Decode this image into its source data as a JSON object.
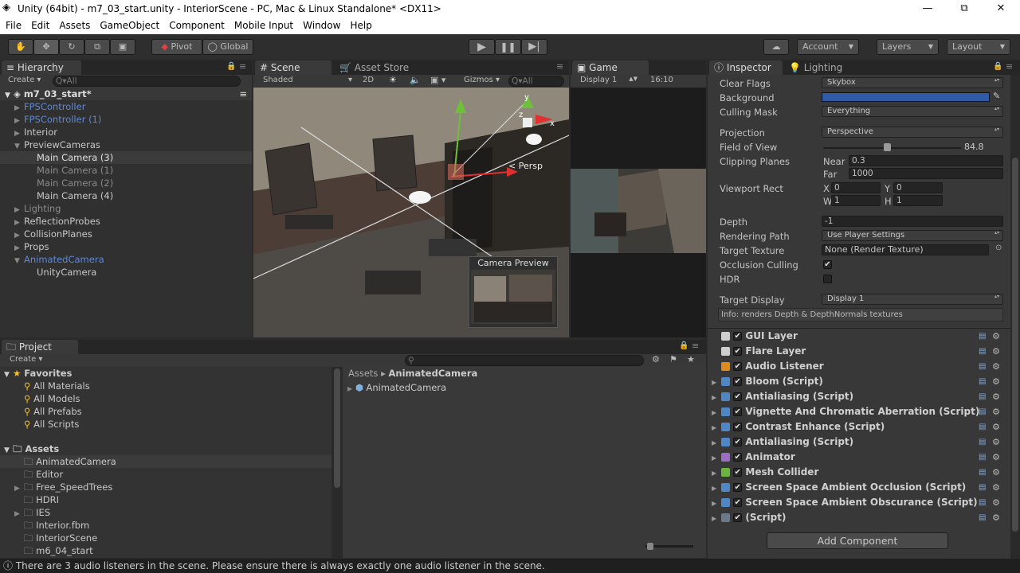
{
  "window": {
    "title": "Unity (64bit) - m7_03_start.unity - InteriorScene - PC, Mac & Linux Standalone* <DX11>"
  },
  "menu": [
    "File",
    "Edit",
    "Assets",
    "GameObject",
    "Component",
    "Mobile Input",
    "Window",
    "Help"
  ],
  "toolbar": {
    "pivot": "Pivot",
    "global": "Global",
    "account": "Account",
    "layers": "Layers",
    "layout": "Layout"
  },
  "hierarchy": {
    "tab": "Hierarchy",
    "create": "Create",
    "search_placeholder": "Q▾All",
    "scene": "m7_03_start*",
    "items": [
      {
        "label": "FPSController",
        "style": "blue",
        "indent": 0,
        "arrow": "▶"
      },
      {
        "label": "FPSController (1)",
        "style": "blue",
        "indent": 0,
        "arrow": "▶"
      },
      {
        "label": "Interior",
        "style": "",
        "indent": 0,
        "arrow": "▶"
      },
      {
        "label": "PreviewCameras",
        "style": "",
        "indent": 0,
        "arrow": "▼"
      },
      {
        "label": "Main Camera (3)",
        "style": "sel",
        "indent": 1,
        "arrow": ""
      },
      {
        "label": "Main Camera (1)",
        "style": "dim",
        "indent": 1,
        "arrow": ""
      },
      {
        "label": "Main Camera (2)",
        "style": "dim",
        "indent": 1,
        "arrow": ""
      },
      {
        "label": "Main Camera (4)",
        "style": "",
        "indent": 1,
        "arrow": ""
      },
      {
        "label": "Lighting",
        "style": "dim",
        "indent": 0,
        "arrow": "▶"
      },
      {
        "label": "ReflectionProbes",
        "style": "",
        "indent": 0,
        "arrow": "▶"
      },
      {
        "label": "CollisionPlanes",
        "style": "",
        "indent": 0,
        "arrow": "▶"
      },
      {
        "label": "Props",
        "style": "",
        "indent": 0,
        "arrow": "▶"
      },
      {
        "label": "AnimatedCamera",
        "style": "blue",
        "indent": 0,
        "arrow": "▼"
      },
      {
        "label": "UnityCamera",
        "style": "",
        "indent": 1,
        "arrow": ""
      }
    ]
  },
  "scene": {
    "tab": "Scene",
    "asset_store_tab": "Asset Store",
    "shading": "Shaded",
    "mode2d": "2D",
    "gizmos": "Gizmos",
    "search": "Q▾All",
    "persp": "< Persp",
    "preview_title": "Camera Preview",
    "axis_y": "y",
    "axis_z": "z",
    "axis_x": "x"
  },
  "game": {
    "tab": "Game",
    "display": "Display 1",
    "aspect": "16:10"
  },
  "inspector": {
    "tab": "Inspector",
    "lighting_tab": "Lighting",
    "clear_flags": {
      "label": "Clear Flags",
      "value": "Skybox"
    },
    "background": {
      "label": "Background",
      "color": "#2e5aa6"
    },
    "culling_mask": {
      "label": "Culling Mask",
      "value": "Everything"
    },
    "projection": {
      "label": "Projection",
      "value": "Perspective"
    },
    "fov": {
      "label": "Field of View",
      "value": "84.8"
    },
    "clipping": {
      "label": "Clipping Planes",
      "near_label": "Near",
      "near": "0.3",
      "far_label": "Far",
      "far": "1000"
    },
    "viewport": {
      "label": "Viewport Rect",
      "x_label": "X",
      "x": "0",
      "y_label": "Y",
      "y": "0",
      "w_label": "W",
      "w": "1",
      "h_label": "H",
      "h": "1"
    },
    "depth": {
      "label": "Depth",
      "value": "-1"
    },
    "rendering_path": {
      "label": "Rendering Path",
      "value": "Use Player Settings"
    },
    "target_texture": {
      "label": "Target Texture",
      "value": "None (Render Texture)"
    },
    "occlusion": {
      "label": "Occlusion Culling",
      "checked": "✔"
    },
    "hdr": {
      "label": "HDR"
    },
    "target_display": {
      "label": "Target Display",
      "value": "Display 1"
    },
    "info": "Info: renders Depth & DepthNormals textures",
    "components": [
      {
        "name": "GUI Layer",
        "color": "#cfcfcf",
        "arrow": ""
      },
      {
        "name": "Flare Layer",
        "color": "#cfcfcf",
        "arrow": ""
      },
      {
        "name": "Audio Listener",
        "color": "#e08a1e",
        "arrow": ""
      },
      {
        "name": "Bloom (Script)",
        "color": "#4f86c6",
        "arrow": "▶"
      },
      {
        "name": "Antialiasing (Script)",
        "color": "#4f86c6",
        "arrow": "▶"
      },
      {
        "name": "Vignette And Chromatic Aberration (Script)",
        "color": "#4f86c6",
        "arrow": "▶"
      },
      {
        "name": "Contrast Enhance (Script)",
        "color": "#4f86c6",
        "arrow": "▶"
      },
      {
        "name": "Antialiasing (Script)",
        "color": "#4f86c6",
        "arrow": "▶"
      },
      {
        "name": "Animator",
        "color": "#9a6cc4",
        "arrow": "▶"
      },
      {
        "name": "Mesh Collider",
        "color": "#6cb33f",
        "arrow": "▶"
      },
      {
        "name": "Screen Space Ambient Occlusion (Script)",
        "color": "#4f86c6",
        "arrow": "▶"
      },
      {
        "name": "Screen Space Ambient Obscurance (Script)",
        "color": "#4f86c6",
        "arrow": "▶"
      },
      {
        "name": "(Script)",
        "color": "#6b7a8a",
        "arrow": "▶"
      }
    ],
    "add_component": "Add Component"
  },
  "project": {
    "tab": "Project",
    "create": "Create",
    "favorites_label": "Favorites",
    "favorites": [
      "All Materials",
      "All Models",
      "All Prefabs",
      "All Scripts"
    ],
    "assets_label": "Assets",
    "assets": [
      {
        "label": "AnimatedCamera",
        "arrow": "",
        "sel": true
      },
      {
        "label": "Editor",
        "arrow": "",
        "sel": false
      },
      {
        "label": "Free_SpeedTrees",
        "arrow": "▶",
        "sel": false
      },
      {
        "label": "HDRI",
        "arrow": "",
        "sel": false
      },
      {
        "label": "IES",
        "arrow": "▶",
        "sel": false
      },
      {
        "label": "Interior.fbm",
        "arrow": "",
        "sel": false
      },
      {
        "label": "InteriorScene",
        "arrow": "",
        "sel": false
      },
      {
        "label": "m6_04_start",
        "arrow": "",
        "sel": false
      }
    ],
    "breadcrumb_root": "Assets",
    "breadcrumb_sep": "▸",
    "breadcrumb_current": "AnimatedCamera",
    "content_item": "AnimatedCamera"
  },
  "status": "There are 3 audio listeners in the scene. Please ensure there is always exactly one audio listener in the scene."
}
